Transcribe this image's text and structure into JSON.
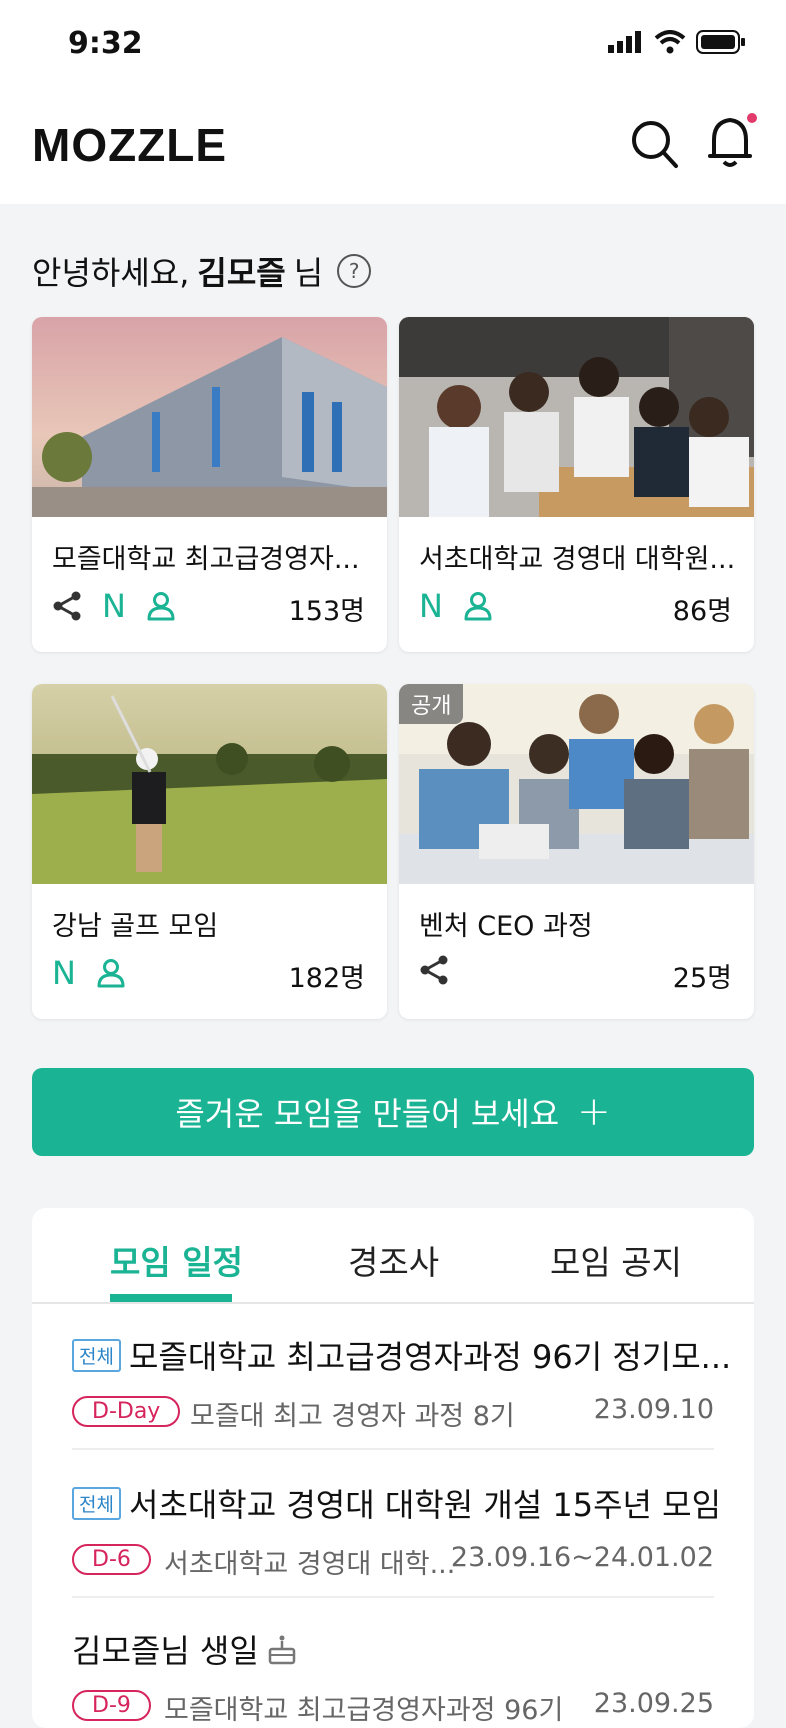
{
  "status": {
    "time": "9:32"
  },
  "header": {
    "logo": "MOZZLE"
  },
  "greeting": {
    "prefix": "안녕하세요, ",
    "name": "김모즐",
    "suffix": "님",
    "help": "?"
  },
  "cards": [
    {
      "title": "모즐대학교 최고급경영자...",
      "count": "153명",
      "badges": [
        "share",
        "N",
        "person"
      ],
      "tag": ""
    },
    {
      "title": "서초대학교 경영대 대학원...",
      "count": "86명",
      "badges": [
        "N",
        "person"
      ],
      "tag": ""
    },
    {
      "title": "강남 골프 모임",
      "count": "182명",
      "badges": [
        "N",
        "person"
      ],
      "tag": ""
    },
    {
      "title": "벤처 CEO 과정",
      "count": "25명",
      "badges": [
        "share"
      ],
      "tag": "공개"
    }
  ],
  "new_badge": "N",
  "cta": {
    "label": "즐거운 모임을 만들어 보세요",
    "plus": "+"
  },
  "tabs": [
    "모임 일정",
    "경조사",
    "모임 공지"
  ],
  "events": [
    {
      "scope": "전체",
      "title": "모즐대학교 최고급경영자과정 96기 정기모...",
      "dday": "D-Day",
      "group": "모즐대 최고 경영자 과정 8기",
      "date": "23.09.10"
    },
    {
      "scope": "전체",
      "title": "서초대학교 경영대 대학원 개설 15주년 모임",
      "dday": "D-6",
      "group": "서초대학교 경영대 대학...",
      "date": "23.09.16~24.01.02"
    },
    {
      "scope": "",
      "title": "김모즐님 생일",
      "dday": "D-9",
      "group": "모즐대학교 최고급경영자과정 96기",
      "date": "23.09.25"
    }
  ],
  "colors": {
    "accent": "#1ab394",
    "dday": "#d6245d",
    "scope": "#2b86c9"
  }
}
